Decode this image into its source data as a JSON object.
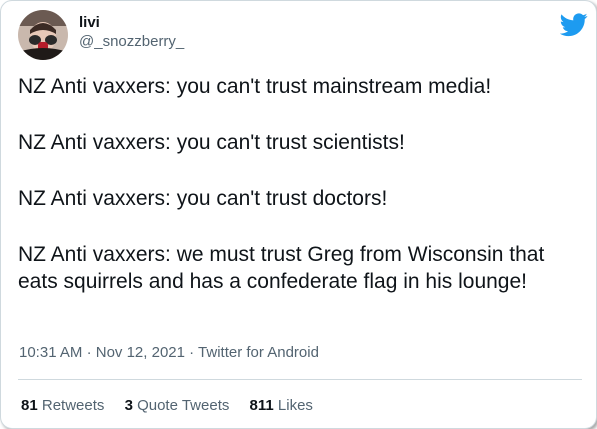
{
  "tweet": {
    "display_name": "livi",
    "handle": "@_snozzberry_",
    "lines": [
      "NZ Anti vaxxers: you can't trust mainstream media!",
      "NZ Anti vaxxers: you can't trust scientists!",
      "NZ Anti vaxxers: you can't trust doctors!",
      "NZ Anti vaxxers: we must trust Greg from Wisconsin that eats squirrels and has a confederate flag in his lounge!"
    ],
    "time": "10:31 AM",
    "date": "Nov 12, 2021",
    "source": "Twitter for Android",
    "separator": "·"
  },
  "stats": {
    "retweets_count": "81",
    "retweets_label": "Retweets",
    "quote_tweets_count": "3",
    "quote_tweets_label": "Quote Tweets",
    "likes_count": "811",
    "likes_label": "Likes"
  },
  "colors": {
    "twitter_blue": "#1d9bf0",
    "text_primary": "#0f1419",
    "text_secondary": "#536471",
    "border": "#cfd9de"
  },
  "icons": {
    "brand": "twitter-bird-icon"
  }
}
